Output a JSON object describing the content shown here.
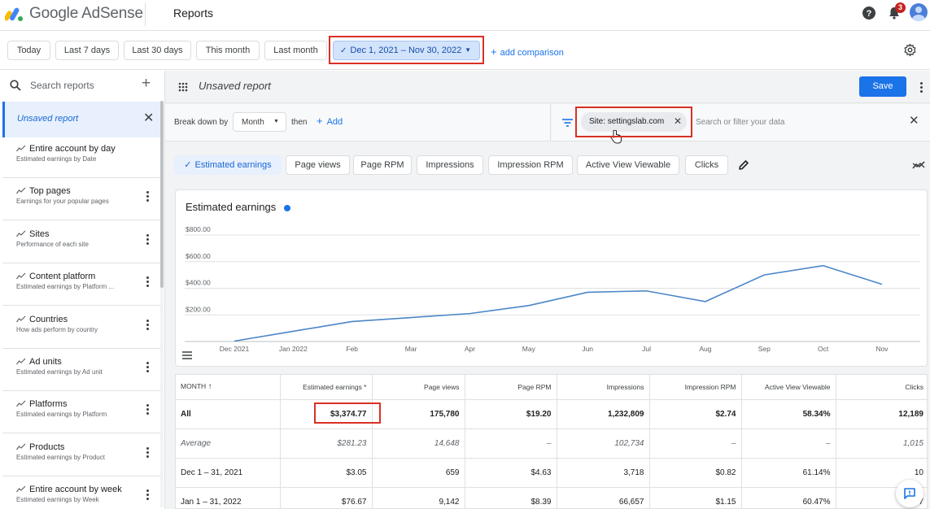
{
  "header": {
    "app_name": "Google AdSense",
    "page_title": "Reports",
    "notification_count": "3"
  },
  "date_ranges": [
    {
      "label": "Today",
      "selected": false
    },
    {
      "label": "Last 7 days",
      "selected": false
    },
    {
      "label": "Last 30 days",
      "selected": false
    },
    {
      "label": "This month",
      "selected": false
    },
    {
      "label": "Last month",
      "selected": false
    },
    {
      "label": "Dec 1, 2021 – Nov 30, 2022",
      "selected": true
    }
  ],
  "add_comparison": "add comparison",
  "sidebar": {
    "search_placeholder": "Search reports",
    "active": "Unsaved report",
    "items": [
      {
        "title": "Entire account by day",
        "subtitle": "Estimated earnings by Date"
      },
      {
        "title": "Top pages",
        "subtitle": "Earnings for your popular pages"
      },
      {
        "title": "Sites",
        "subtitle": "Performance of each site"
      },
      {
        "title": "Content platform",
        "subtitle": "Estimated earnings by Platform ..."
      },
      {
        "title": "Countries",
        "subtitle": "How ads perform by country"
      },
      {
        "title": "Ad units",
        "subtitle": "Estimated earnings by Ad unit"
      },
      {
        "title": "Platforms",
        "subtitle": "Estimated earnings by Platform"
      },
      {
        "title": "Products",
        "subtitle": "Estimated earnings by Product"
      },
      {
        "title": "Entire account by week",
        "subtitle": "Estimated earnings by Week"
      }
    ]
  },
  "toolbar": {
    "report_title": "Unsaved report",
    "save_label": "Save"
  },
  "breakdown": {
    "label": "Break down by",
    "value": "Month",
    "then": "then",
    "add": "Add"
  },
  "filter": {
    "chip": "Site: settingslab.com",
    "placeholder": "Search or filter your data"
  },
  "metrics": [
    "Estimated earnings",
    "Page views",
    "Page RPM",
    "Impressions",
    "Impression RPM",
    "Active View Viewable",
    "Clicks"
  ],
  "chart_data": {
    "type": "line",
    "title": "Estimated earnings",
    "x": [
      "Dec 2021",
      "Jan 2022",
      "Feb",
      "Mar",
      "Apr",
      "May",
      "Jun",
      "Jul",
      "Aug",
      "Sep",
      "Oct",
      "Nov"
    ],
    "series": [
      {
        "values": [
          3.05,
          76.67,
          150,
          180,
          210,
          270,
          370,
          380,
          300,
          500,
          570,
          430
        ]
      }
    ],
    "yticks": [
      "$200.00",
      "$400.00",
      "$600.00",
      "$800.00"
    ],
    "ylim": [
      0,
      800
    ],
    "grid": true,
    "color": "#4a86c8"
  },
  "table": {
    "headers": [
      "MONTH",
      "Estimated earnings *",
      "Page views",
      "Page RPM",
      "Impressions",
      "Impression RPM",
      "Active View Viewable",
      "Clicks"
    ],
    "total": [
      "All",
      "$3,374.77",
      "175,780",
      "$19.20",
      "1,232,809",
      "$2.74",
      "58.34%",
      "12,189"
    ],
    "average": [
      "Average",
      "$281.23",
      "14,648",
      "–",
      "102,734",
      "–",
      "–",
      "1,015"
    ],
    "rows": [
      [
        "Dec 1 – 31, 2021",
        "$3.05",
        "659",
        "$4.63",
        "3,718",
        "$0.82",
        "61.14%",
        "10"
      ],
      [
        "Jan 1 – 31, 2022",
        "$76.67",
        "9,142",
        "$8.39",
        "66,657",
        "$1.15",
        "60.47%",
        "17"
      ]
    ]
  },
  "colors": {
    "accent": "#1a73e8",
    "highlight": "#d93025"
  }
}
